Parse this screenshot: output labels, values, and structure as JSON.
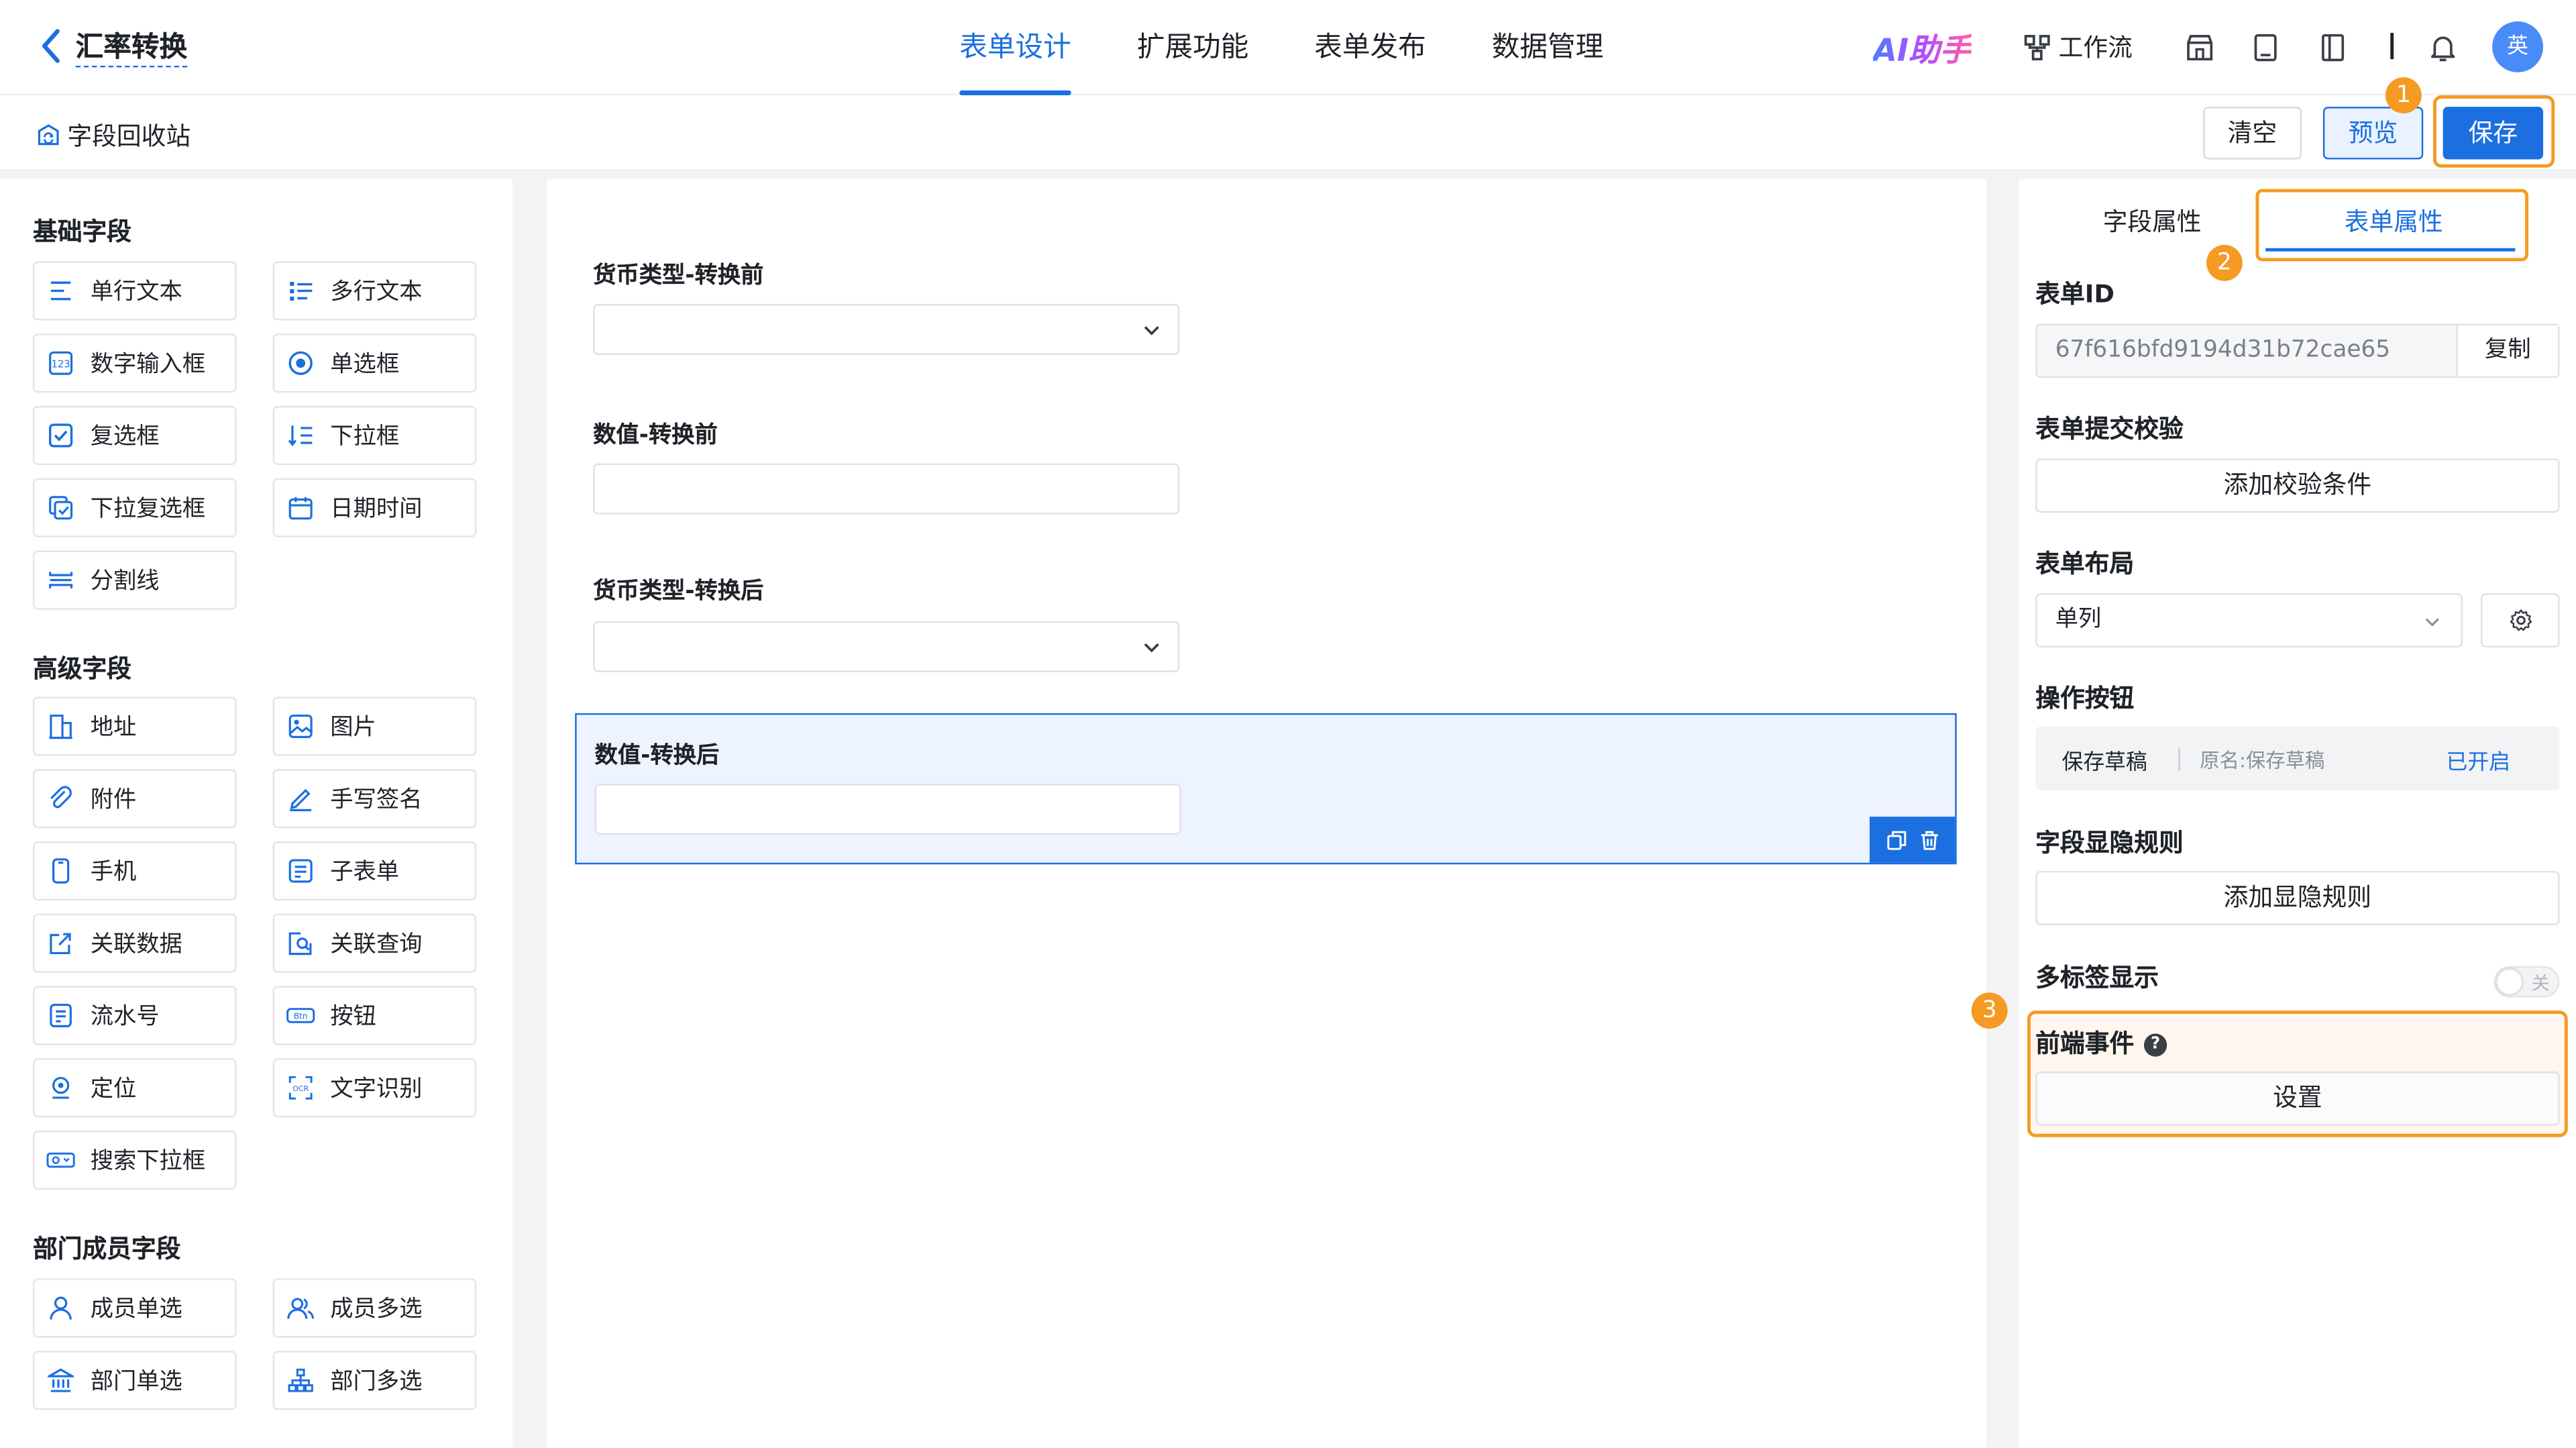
{
  "header": {
    "back_title": "汇率转换",
    "nav_tabs": [
      {
        "label": "表单设计"
      },
      {
        "label": "扩展功能"
      },
      {
        "label": "表单发布"
      },
      {
        "label": "数据管理"
      }
    ],
    "ai_label": "AI助手",
    "workflow_label": "工作流",
    "avatar_text": "英"
  },
  "subbar": {
    "recycle_label": "字段回收站",
    "clear_label": "清空",
    "preview_label": "预览",
    "save_label": "保存"
  },
  "badges": {
    "b1": "1",
    "b2": "2",
    "b3": "3"
  },
  "left_panel": {
    "basic_title": "基础字段",
    "basic": [
      "单行文本",
      "多行文本",
      "数字输入框",
      "单选框",
      "复选框",
      "下拉框",
      "下拉复选框",
      "日期时间",
      "分割线"
    ],
    "advanced_title": "高级字段",
    "advanced": [
      "地址",
      "图片",
      "附件",
      "手写签名",
      "手机",
      "子表单",
      "关联数据",
      "关联查询",
      "流水号",
      "按钮",
      "定位",
      "文字识别",
      "搜索下拉框"
    ],
    "member_title": "部门成员字段",
    "member": [
      "成员单选",
      "成员多选",
      "部门单选",
      "部门多选"
    ]
  },
  "canvas": {
    "fields": [
      {
        "label": "货币类型-转换前",
        "type": "select"
      },
      {
        "label": "数值-转换前",
        "type": "input"
      },
      {
        "label": "货币类型-转换后",
        "type": "select"
      },
      {
        "label": "数值-转换后",
        "type": "input",
        "selected": true
      }
    ]
  },
  "right_panel": {
    "tab_field": "字段属性",
    "tab_form": "表单属性",
    "form_id_label": "表单ID",
    "form_id_value": "67f616bfd9194d31b72cae65",
    "copy_label": "复制",
    "submit_check_label": "表单提交校验",
    "add_check_label": "添加校验条件",
    "layout_label": "表单布局",
    "layout_value": "单列",
    "op_buttons_label": "操作按钮",
    "op_name": "保存草稿",
    "op_original": "原名:保存草稿",
    "op_status": "已开启",
    "visibility_label": "字段显隐规则",
    "add_visibility_label": "添加显隐规则",
    "multitab_label": "多标签显示",
    "multitab_toggle": "关",
    "frontend_event_label": "前端事件",
    "help_glyph": "?",
    "settings_label": "设置"
  },
  "colors": {
    "accent": "#1b6fe0",
    "highlight": "#f59a23"
  }
}
